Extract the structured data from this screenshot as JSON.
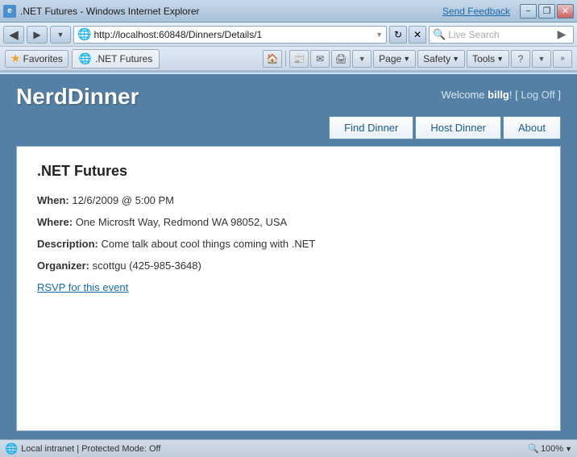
{
  "titlebar": {
    "title": ".NET Futures - Windows Internet Explorer",
    "send_feedback": "Send Feedback",
    "min": "−",
    "restore": "❐",
    "close": "✕"
  },
  "addressbar": {
    "url": "http://localhost:60848/Dinners/Details/1",
    "live_search_placeholder": "Live Search",
    "back_icon": "◀",
    "forward_icon": "▶",
    "refresh_icon": "↻",
    "stop_icon": "✕",
    "go_icon": "▶",
    "search_go_icon": "🔍"
  },
  "toolbar": {
    "favorites_label": "Favorites",
    "tabs": [
      {
        "label": ".NET Futures",
        "active": true
      }
    ],
    "page_label": "Page",
    "safety_label": "Safety",
    "tools_label": "Tools",
    "help_icon": "?"
  },
  "app": {
    "title": "NerdDinner",
    "welcome_text": "Welcome ",
    "username": "billg",
    "welcome_suffix": "!",
    "logoff_open": "[ ",
    "logoff_link": "Log Off",
    "logoff_close": " ]",
    "nav": {
      "find_dinner": "Find Dinner",
      "host_dinner": "Host Dinner",
      "about": "About"
    }
  },
  "dinner": {
    "title": ".NET Futures",
    "when_label": "When:",
    "when_value": "12/6/2009 @ 5:00 PM",
    "where_label": "Where:",
    "where_value": "One Microsft Way, Redmond WA 98052, USA",
    "description_label": "Description:",
    "description_value": "Come talk about cool things coming with .NET",
    "organizer_label": "Organizer:",
    "organizer_value": "scottgu (425-985-3648)",
    "rsvp_link": "RSVP for this event"
  },
  "statusbar": {
    "zone": "Local intranet | Protected Mode: Off",
    "zoom": "100%",
    "zoom_icon": "🔍"
  }
}
